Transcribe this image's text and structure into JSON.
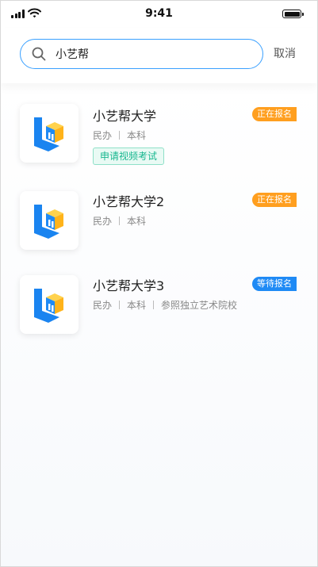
{
  "status_bar": {
    "time": "9:41"
  },
  "search": {
    "query": "小艺帮",
    "cancel_label": "取消"
  },
  "results": [
    {
      "name": "小艺帮大学",
      "meta": [
        "民办",
        "本科"
      ],
      "badge": "正在报名",
      "badge_color": "#ff9f1f",
      "action": "申请视频考试"
    },
    {
      "name": "小艺帮大学2",
      "meta": [
        "民办",
        "本科"
      ],
      "badge": "正在报名",
      "badge_color": "#ff9f1f"
    },
    {
      "name": "小艺帮大学3",
      "meta": [
        "民办",
        "本科",
        "参照独立艺术院校"
      ],
      "badge": "等待报名",
      "badge_color": "#1f8af5"
    }
  ],
  "colors": {
    "accent": "#3aa0ff",
    "logo_blue": "#1a84f0",
    "logo_yellow": "#ffc21a"
  },
  "icons": [
    "search-icon",
    "signal-icon",
    "wifi-icon",
    "battery-icon",
    "school-logo-icon"
  ]
}
